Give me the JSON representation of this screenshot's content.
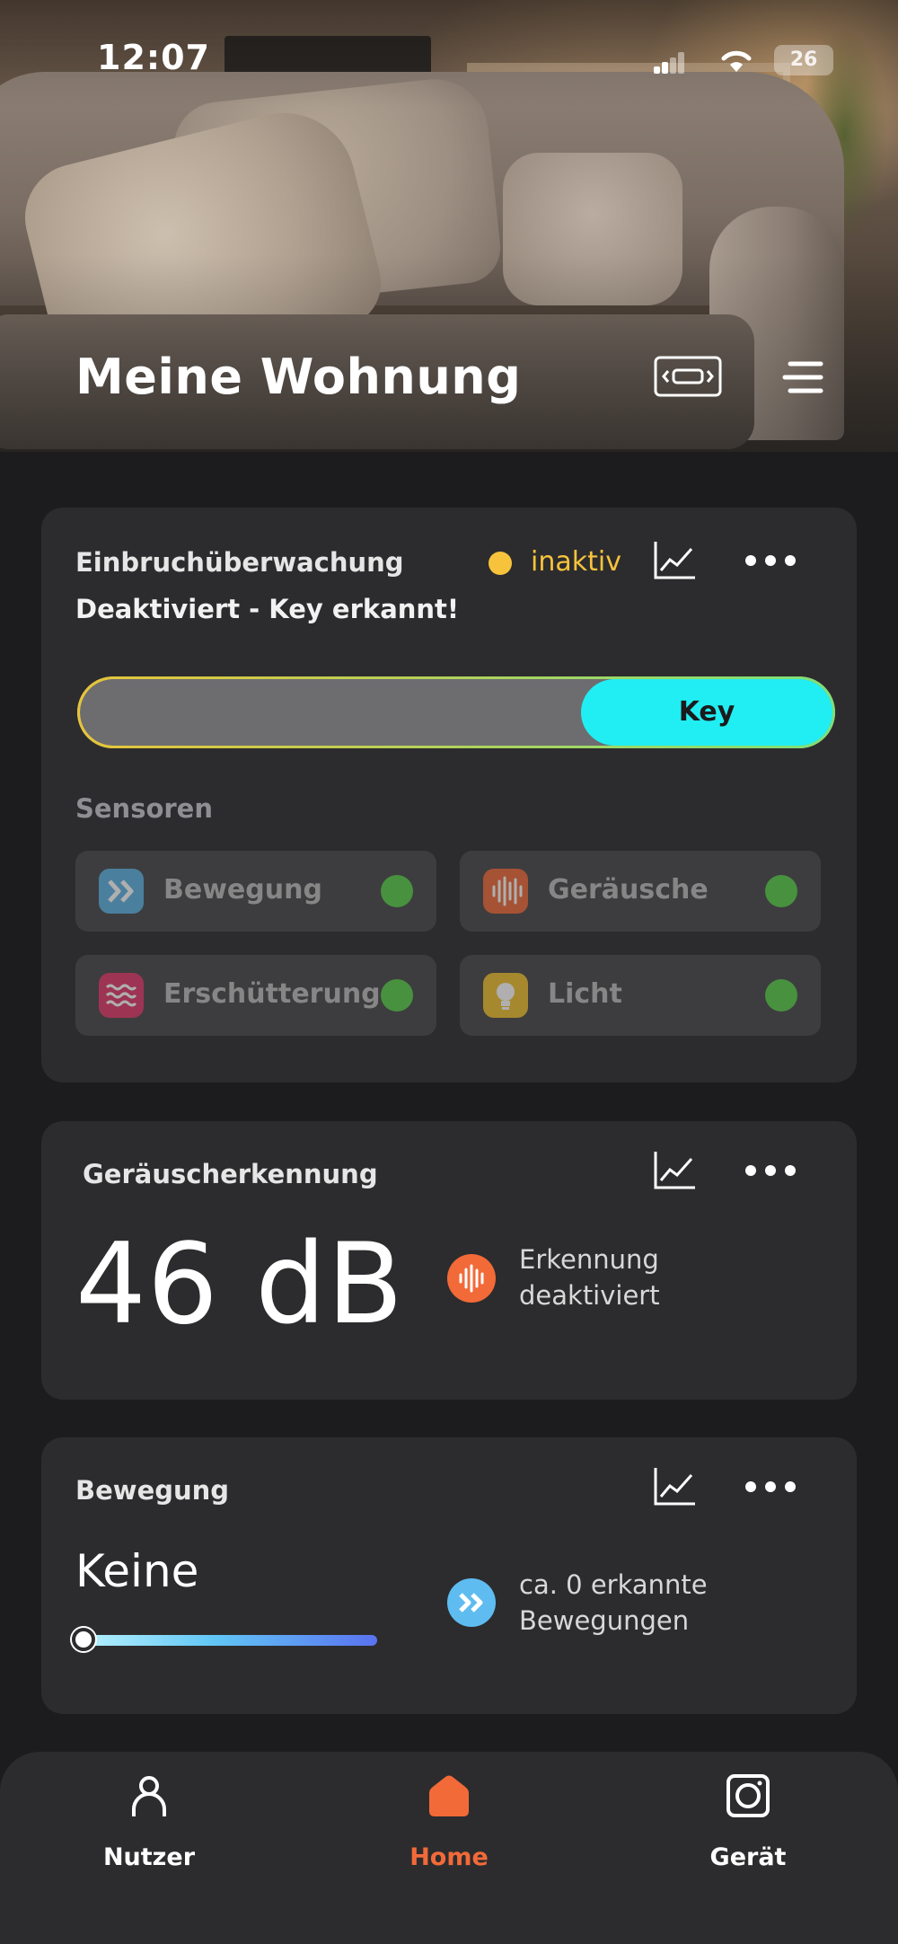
{
  "status_bar": {
    "time": "12:07",
    "battery": "26"
  },
  "header": {
    "title": "Meine Wohnung"
  },
  "intrusion": {
    "title": "Einbruchüberwachung",
    "status": "inaktiv",
    "status_color": "#f7c33c",
    "subtitle": "Deaktiviert - Key erkannt!",
    "slider_label": "Key",
    "sensors_label": "Sensoren",
    "sensors": [
      {
        "label": "Bewegung",
        "icon": "motion-icon",
        "color": "#5eb3e3",
        "active": true
      },
      {
        "label": "Geräusche",
        "icon": "sound-wave-icon",
        "color": "#f26a38",
        "active": true
      },
      {
        "label": "Erschütterung",
        "icon": "vibration-icon",
        "color": "#e23a6a",
        "active": true
      },
      {
        "label": "Licht",
        "icon": "lightbulb-icon",
        "color": "#f2c12e",
        "active": true
      }
    ]
  },
  "noise": {
    "title": "Geräuscherkennung",
    "value": "46 dB",
    "info": "Erkennung deaktiviert"
  },
  "motion": {
    "title": "Bewegung",
    "value": "Keine",
    "level": 0,
    "info": "ca. 0 erkannte Bewegungen"
  },
  "tabs": [
    {
      "label": "Nutzer",
      "icon": "user-icon",
      "active": false
    },
    {
      "label": "Home",
      "icon": "home-icon",
      "active": true
    },
    {
      "label": "Gerät",
      "icon": "device-icon",
      "active": false
    }
  ],
  "colors": {
    "accent": "#f26a38",
    "key": "#21eef3",
    "sensor_ok": "#5ad04a"
  }
}
